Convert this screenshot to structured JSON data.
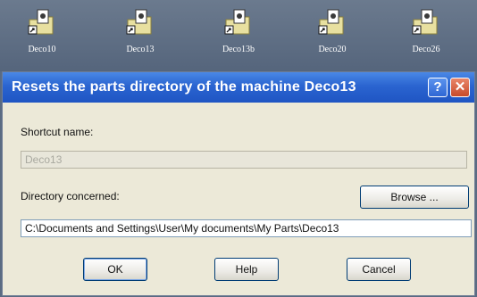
{
  "desktop": {
    "icons": [
      {
        "label": "Deco10"
      },
      {
        "label": "Deco13"
      },
      {
        "label": "Deco13b"
      },
      {
        "label": "Deco20"
      },
      {
        "label": "Deco26"
      }
    ],
    "icon_colors": {
      "folder": "#e8e0a0",
      "page": "#ffffff",
      "shortcut_arrow": "#1a1a1a"
    }
  },
  "dialog": {
    "title": "Resets the parts directory of the machine Deco13",
    "help_glyph": "?",
    "close_glyph": "✕",
    "shortcut_label": "Shortcut name:",
    "shortcut_value": "Deco13",
    "directory_label": "Directory concerned:",
    "browse_label": "Browse ...",
    "directory_value": "C:\\Documents and Settings\\User\\My documents\\My Parts\\Deco13",
    "ok_label": "OK",
    "help_label": "Help",
    "cancel_label": "Cancel",
    "colors": {
      "title_bar": "#2a64d0",
      "dialog_bg": "#ece9d8",
      "close": "#c84a2a"
    }
  }
}
